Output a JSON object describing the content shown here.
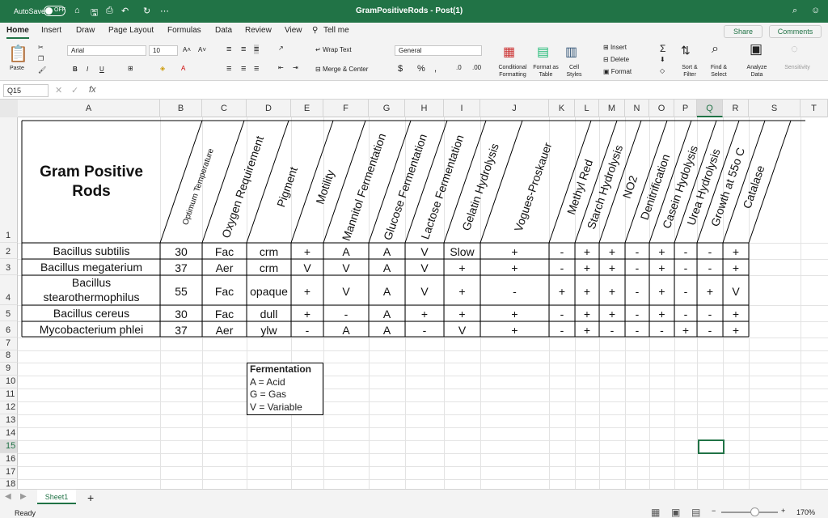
{
  "titlebar": {
    "autosave": "AutoSave",
    "toggle": "OFF",
    "title": "GramPositiveRods - Post(1)"
  },
  "tabs": [
    "Home",
    "Insert",
    "Draw",
    "Page Layout",
    "Formulas",
    "Data",
    "Review",
    "View",
    "Tell me"
  ],
  "share": "Share",
  "comments": "Comments",
  "ribbon": {
    "paste": "Paste",
    "font": "Arial",
    "size": "10",
    "wrap": "Wrap Text",
    "merge": "Merge & Center",
    "numfmt": "General",
    "conditional": "Conditional Formatting",
    "format_table": "Format as Table",
    "cell_styles": "Cell Styles",
    "insert": "Insert",
    "delete": "Delete",
    "format": "Format",
    "sort": "Sort & Filter",
    "find": "Find & Select",
    "analyze": "Analyze Data",
    "sensitivity": "Sensitivity"
  },
  "namebox": "Q15",
  "fx": "fx",
  "columns": [
    "A",
    "B",
    "C",
    "D",
    "E",
    "F",
    "G",
    "H",
    "I",
    "J",
    "K",
    "L",
    "M",
    "N",
    "O",
    "P",
    "Q",
    "R",
    "S",
    "T"
  ],
  "rows": [
    "1",
    "2",
    "3",
    "4",
    "5",
    "6",
    "7",
    "8",
    "9",
    "10",
    "11",
    "12",
    "13",
    "14",
    "15",
    "16",
    "17",
    "18"
  ],
  "sheet": {
    "title": "Gram Positive Rods",
    "headers": [
      "Optimum Temperature",
      "Oxygen Requirement",
      "Pigment",
      "Motility",
      "Mannitol Fermentation",
      "Glucose Fermentation",
      "Lactose Fermentation",
      "Gelatin Hydrolysis",
      "Vogues-Proskauer",
      "Methyl Red",
      "Starch Hydrolysis",
      "NO2",
      "Denitrification",
      "Casein Hydolysis",
      "Urea Hydrolysis",
      "Growth at 55o C",
      "Catalase"
    ],
    "organisms": [
      "Bacillus subtilis",
      "Bacillus megaterium",
      "Bacillus stearothermophilus",
      "Bacillus cereus",
      "Mycobacterium phlei"
    ],
    "data": [
      [
        "30",
        "Fac",
        "crm",
        "+",
        "A",
        "A",
        "V",
        "Slow",
        "+",
        "-",
        "+",
        "+",
        "-",
        "+",
        "-",
        "-",
        "+"
      ],
      [
        "37",
        "Aer",
        "crm",
        "V",
        "V",
        "A",
        "V",
        "+",
        "+",
        "-",
        "+",
        "+",
        "-",
        "+",
        "-",
        "-",
        "+"
      ],
      [
        "55",
        "Fac",
        "opaque",
        "+",
        "V",
        "A",
        "V",
        "+",
        "-",
        "+",
        "+",
        "+",
        "-",
        "+",
        "-",
        "+",
        "V"
      ],
      [
        "30",
        "Fac",
        "dull",
        "+",
        "-",
        "A",
        "+",
        "+",
        "+",
        "-",
        "+",
        "+",
        "-",
        "+",
        "-",
        "-",
        "+"
      ],
      [
        "37",
        "Aer",
        "ylw",
        "-",
        "A",
        "A",
        "-",
        "V",
        "+",
        "-",
        "+",
        "-",
        "-",
        "-",
        "+",
        "-",
        "+"
      ]
    ],
    "legend": {
      "title": "Fermentation",
      "lines": [
        "A = Acid",
        "G = Gas",
        "V = Variable"
      ]
    }
  },
  "status": {
    "ready": "Ready",
    "sheet_tab": "Sheet1",
    "zoom": "170%"
  }
}
